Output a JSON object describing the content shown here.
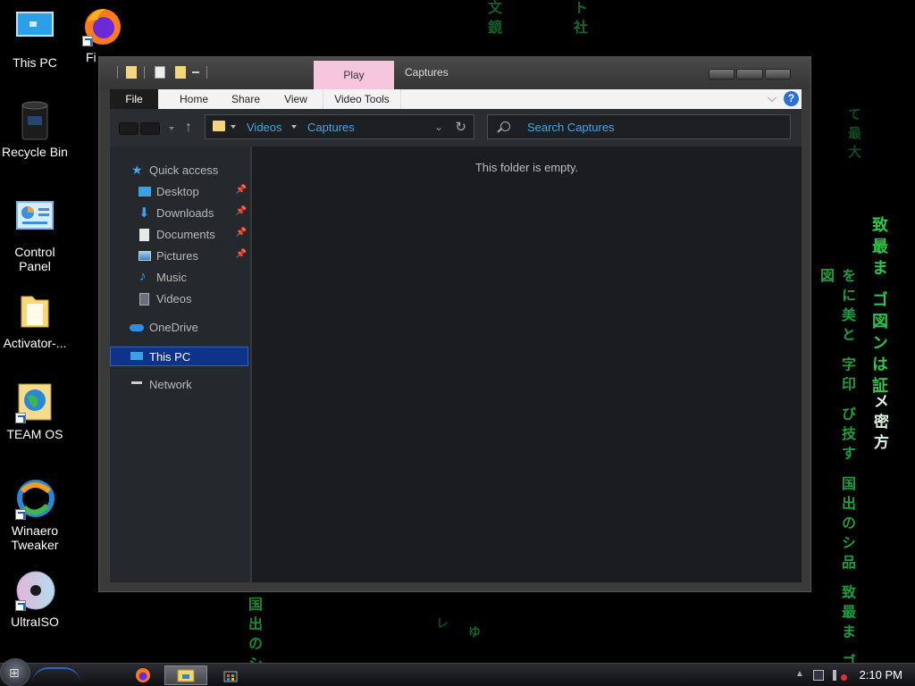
{
  "wallpaper": {
    "columns": [
      "致最ま ゴ図ンは証",
      "をに美と 字印 び技す 国出のシ品 致最ま ゴ図",
      "国出のシ",
      "文鏡",
      "ト社",
      "て最大",
      "レ",
      "ゆ",
      "メ密方"
    ]
  },
  "desktop": {
    "icons": [
      {
        "label": "This PC",
        "icon": "monitor-icon"
      },
      {
        "label": "Fi",
        "icon": "firefox-icon"
      },
      {
        "label": "Recycle Bin",
        "icon": "recycle-bin-icon"
      },
      {
        "label": "Control Panel",
        "icon": "control-panel-icon"
      },
      {
        "label": "Activator-...",
        "icon": "folder-icon"
      },
      {
        "label": "TEAM OS",
        "icon": "globe-icon"
      },
      {
        "label": "Winaero Tweaker",
        "icon": "winaero-icon"
      },
      {
        "label": "UltraISO",
        "icon": "disc-icon"
      }
    ]
  },
  "window": {
    "title": "Captures",
    "contextual_tab": "Play",
    "ribbon": {
      "tabs": [
        "File",
        "Home",
        "Share",
        "View",
        "Video Tools"
      ],
      "help": "?"
    },
    "address": {
      "crumbs": [
        "Videos",
        "Captures"
      ]
    },
    "search": {
      "placeholder": "Search Captures"
    },
    "nav": {
      "items": [
        {
          "label": "Quick access",
          "icon": "star-icon"
        },
        {
          "label": "Desktop",
          "icon": "desktop-icon",
          "pinned": true
        },
        {
          "label": "Downloads",
          "icon": "download-icon",
          "pinned": true
        },
        {
          "label": "Documents",
          "icon": "document-icon",
          "pinned": true
        },
        {
          "label": "Pictures",
          "icon": "pictures-icon",
          "pinned": true
        },
        {
          "label": "Music",
          "icon": "music-icon"
        },
        {
          "label": "Videos",
          "icon": "videos-icon"
        },
        {
          "label": "OneDrive",
          "icon": "cloud-icon"
        },
        {
          "label": "This PC",
          "icon": "computer-icon",
          "selected": true
        },
        {
          "label": "Network",
          "icon": "network-icon"
        }
      ]
    },
    "content": {
      "empty_message": "This folder is empty."
    }
  },
  "taskbar": {
    "clock": "2:10 PM",
    "apps": [
      "firefox-icon",
      "file-explorer-icon",
      "store-icon"
    ]
  },
  "colors": {
    "accent": "#4aa3e6",
    "selection": "#10338a",
    "matrix": "#2ec54d",
    "play_tab": "#f6c6dd"
  }
}
